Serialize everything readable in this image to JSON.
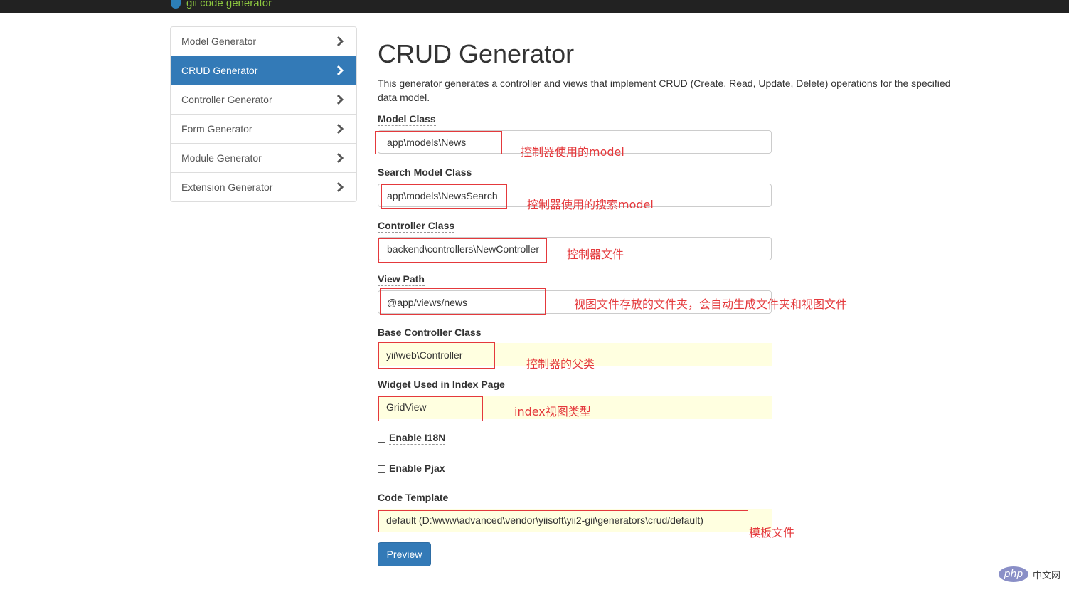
{
  "header": {
    "brand": "gii code generator"
  },
  "sidebar": {
    "items": [
      {
        "label": "Model Generator",
        "active": false
      },
      {
        "label": "CRUD Generator",
        "active": true
      },
      {
        "label": "Controller Generator",
        "active": false
      },
      {
        "label": "Form Generator",
        "active": false
      },
      {
        "label": "Module Generator",
        "active": false
      },
      {
        "label": "Extension Generator",
        "active": false
      }
    ],
    "chevron_icon": "chevron-right-icon"
  },
  "main": {
    "title": "CRUD Generator",
    "description": "This generator generates a controller and views that implement CRUD (Create, Read, Update, Delete) operations for the specified data model."
  },
  "fields": {
    "model_class": {
      "label": "Model Class",
      "value": "app\\models\\News",
      "annotation": "控制器使用的model"
    },
    "search_model_class": {
      "label": "Search Model Class",
      "value": "app\\models\\NewsSearch",
      "annotation": "控制器使用的搜索model"
    },
    "controller_class": {
      "label": "Controller Class",
      "value": "backend\\controllers\\NewController",
      "annotation": "控制器文件"
    },
    "view_path": {
      "label": "View Path",
      "value": "@app/views/news",
      "annotation": "视图文件存放的文件夹，会自动生成文件夹和视图文件"
    },
    "base_controller_class": {
      "label": "Base Controller Class",
      "value": "yii\\web\\Controller",
      "annotation": "控制器的父类"
    },
    "index_widget": {
      "label": "Widget Used in Index Page",
      "value": "GridView",
      "annotation": "index视图类型"
    },
    "code_template": {
      "label": "Code Template",
      "value": "default (D:\\www\\advanced\\vendor\\yiisoft\\yii2-gii\\generators\\crud/default)",
      "annotation": "模板文件"
    }
  },
  "checkboxes": {
    "enable_i18n": {
      "label": "Enable I18N",
      "checked": false
    },
    "enable_pjax": {
      "label": "Enable Pjax",
      "checked": false
    }
  },
  "actions": {
    "preview_label": "Preview"
  },
  "watermark": {
    "logo_text": "php",
    "site_text": "中文网"
  },
  "colors": {
    "primary": "#337ab7",
    "annotation_red": "#e4393c",
    "sticky_bg": "#ffffe0",
    "topbar": "#222222"
  }
}
